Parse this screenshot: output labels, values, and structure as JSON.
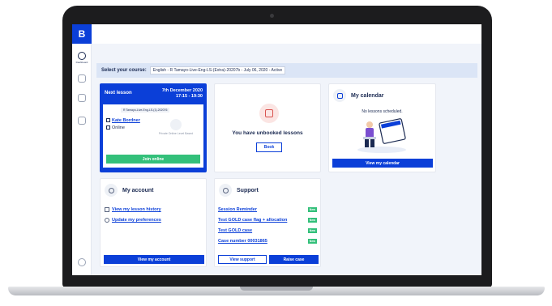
{
  "app": {
    "logo": "B"
  },
  "sidebar": {
    "items": [
      {
        "label": "Dashboard",
        "icon": "dashboard-icon"
      },
      {
        "label": "",
        "icon": "lessons-icon"
      },
      {
        "label": "",
        "icon": "learning-icon"
      },
      {
        "label": "",
        "icon": "profile-icon"
      },
      {
        "label": "",
        "icon": "help-icon"
      }
    ]
  },
  "course": {
    "label": "Select your course:",
    "selected": "English - R Tamayo-Live-Eng-LS-(Extra)-20207b - July 06, 2020 - Active"
  },
  "next_lesson": {
    "title": "Next lesson",
    "date": "7th December 2020",
    "time": "17:15 - 19:30",
    "course_tag": "R Tamayo-Live-Eng-LS-(1)-202076",
    "teacher": "Kate Bordner",
    "mode": "Online",
    "type": "Private Online Level Based",
    "join_label": "Join online"
  },
  "unbooked": {
    "message": "You have unbooked lessons",
    "book_label": "Book"
  },
  "calendar": {
    "title": "My calendar",
    "empty": "No lessons scheduled.",
    "button": "View my calendar"
  },
  "account": {
    "title": "My account",
    "links": [
      "View my lesson history",
      "Update my preferences"
    ],
    "button": "View my account"
  },
  "support": {
    "title": "Support",
    "items": [
      {
        "label": "Session Reminder",
        "badge": "New"
      },
      {
        "label": "Test GOLD case flag + allocation",
        "badge": "New"
      },
      {
        "label": "Test GOLD case",
        "badge": "New"
      },
      {
        "label": "Case number 00031865",
        "badge": "New"
      }
    ],
    "view_label": "View support",
    "raise_label": "Raise case"
  },
  "colors": {
    "brand": "#0b3fd8",
    "success": "#33c07a",
    "text": "#1b2a52"
  }
}
